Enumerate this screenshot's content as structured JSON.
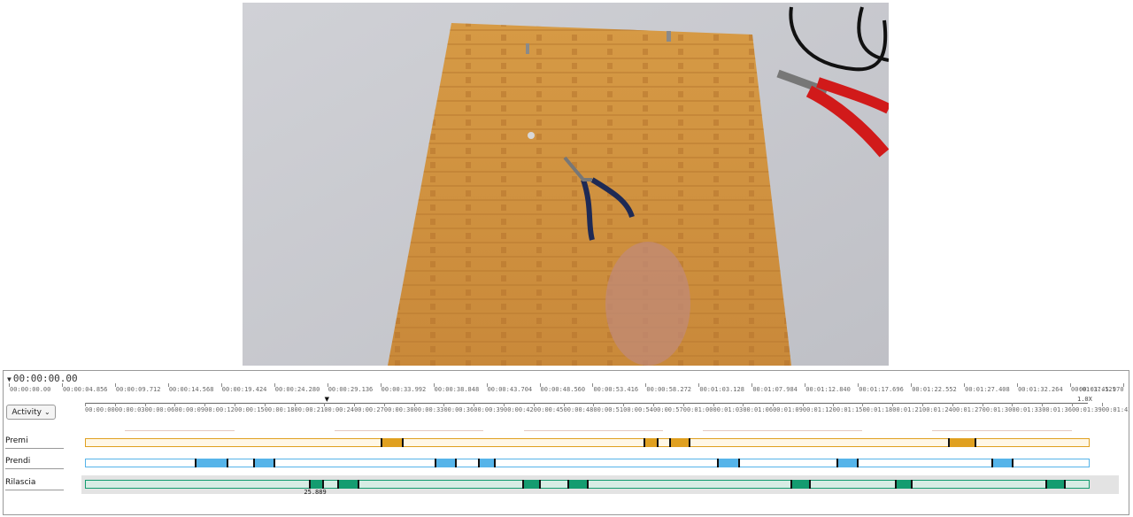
{
  "time_readout": "00:00:00.00",
  "activity_button": {
    "label": "Activity",
    "icon": "chevron-down-icon"
  },
  "zoom": "1.0X",
  "ruler_top": [
    "00:00:00.00",
    "00:00:04.856",
    "00:00:09.712",
    "00:00:14.568",
    "00:00:19.424",
    "00:00:24.280",
    "00:00:29.136",
    "00:00:33.992",
    "00:00:38.848",
    "00:00:43.704",
    "00:00:48.560",
    "00:00:53.416",
    "00:00:58.272",
    "00:01:03.128",
    "00:01:07.984",
    "00:01:12.840",
    "00:01:17.696",
    "00:01:22.552",
    "00:01:27.408",
    "00:01:32.264",
    "00:01:37.121",
    "00:01:45.970"
  ],
  "ruler_bottom": [
    "00:00:00",
    "00:00:03",
    "00:00:06",
    "00:00:09",
    "00:00:12",
    "00:00:15",
    "00:00:18",
    "00:00:21",
    "00:00:24",
    "00:00:27",
    "00:00:30",
    "00:00:33",
    "00:00:36",
    "00:00:39",
    "00:00:42",
    "00:00:45",
    "00:00:48",
    "00:00:51",
    "00:00:54",
    "00:00:57",
    "00:01:00",
    "00:01:03",
    "00:01:06",
    "00:01:09",
    "00:01:12",
    "00:01:15",
    "00:01:18",
    "00:01:21",
    "00:01:24",
    "00:01:27",
    "00:01:30",
    "00:01:33",
    "00:01:36",
    "00:01:39",
    "00:01:42",
    "00:01:45"
  ],
  "tracks": [
    {
      "label": "Premi",
      "color": "#e0a020",
      "fill": "#fff7e6",
      "segments": [
        [
          29.7,
          32.0
        ],
        [
          56.0,
          57.5
        ],
        [
          58.6,
          60.7
        ],
        [
          86.6,
          89.4
        ]
      ]
    },
    {
      "label": "Prendi",
      "color": "#56b4e9",
      "fill": "#ffffff",
      "segments": [
        [
          11.0,
          14.4
        ],
        [
          16.9,
          19.1
        ],
        [
          35.1,
          37.3
        ],
        [
          39.4,
          41.2
        ],
        [
          63.4,
          65.7
        ],
        [
          75.4,
          77.6
        ],
        [
          90.9,
          93.1
        ]
      ]
    },
    {
      "label": "Rilascia",
      "color": "#149c70",
      "fill": "#d7ece4",
      "segments": [
        [
          22.5,
          24.0
        ],
        [
          25.3,
          27.5
        ],
        [
          43.9,
          45.7
        ],
        [
          48.4,
          50.5
        ],
        [
          70.8,
          72.8
        ],
        [
          81.2,
          83.0
        ],
        [
          96.3,
          98.4
        ]
      ]
    }
  ],
  "selection_duration": "25.889",
  "timeline_max_seconds": 100.6
}
